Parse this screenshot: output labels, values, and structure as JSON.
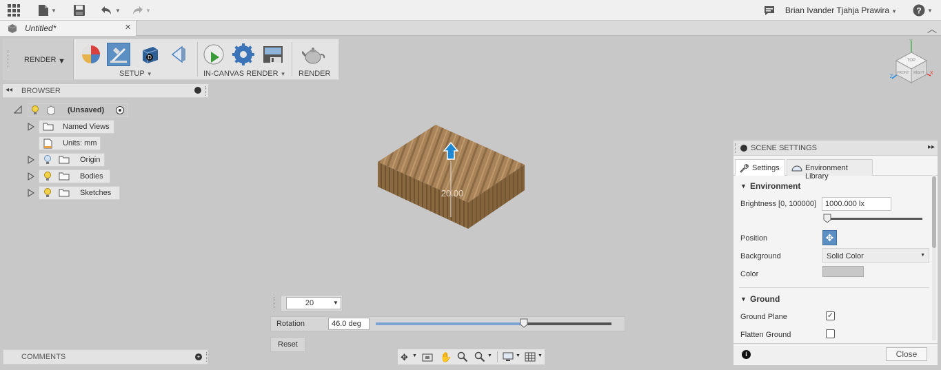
{
  "topbar": {
    "user_name": "Brian Ivander Tjahja Prawira",
    "help_label": "?"
  },
  "tab": {
    "title": "Untitled*",
    "close": "×"
  },
  "toolbar": {
    "workspace": "RENDER",
    "setup_label": "SETUP",
    "in_canvas_label": "IN-CANVAS RENDER",
    "render_label": "RENDER"
  },
  "browser": {
    "title": "BROWSER",
    "root": "(Unsaved)",
    "items": [
      {
        "label": "Named Views"
      },
      {
        "label": "Units: mm"
      },
      {
        "label": "Origin"
      },
      {
        "label": "Bodies"
      },
      {
        "label": "Sketches"
      }
    ]
  },
  "viewport": {
    "dimension_label": "20.00",
    "dim_input_value": "20",
    "rotation_label": "Rotation",
    "rotation_value": "46.0 deg",
    "rotation_fraction": 0.63,
    "reset_label": "Reset",
    "viewcube_top": "TOP",
    "viewcube_front": "FRONT",
    "viewcube_right": "RIGHT"
  },
  "comments": {
    "title": "COMMENTS"
  },
  "scene_settings": {
    "title": "SCENE SETTINGS",
    "tab_settings": "Settings",
    "tab_env_library": "Environment Library",
    "section_environment": "Environment",
    "brightness_label": "Brightness [0, 100000]",
    "brightness_value": "1000.000 lx",
    "brightness_fraction": 0.01,
    "position_label": "Position",
    "background_label": "Background",
    "background_value": "Solid Color",
    "color_label": "Color",
    "section_ground": "Ground",
    "ground_plane_label": "Ground Plane",
    "ground_plane_checked": true,
    "flatten_ground_label": "Flatten Ground",
    "flatten_ground_checked": false,
    "close_label": "Close",
    "swatch_color": "#c8c8c8"
  }
}
